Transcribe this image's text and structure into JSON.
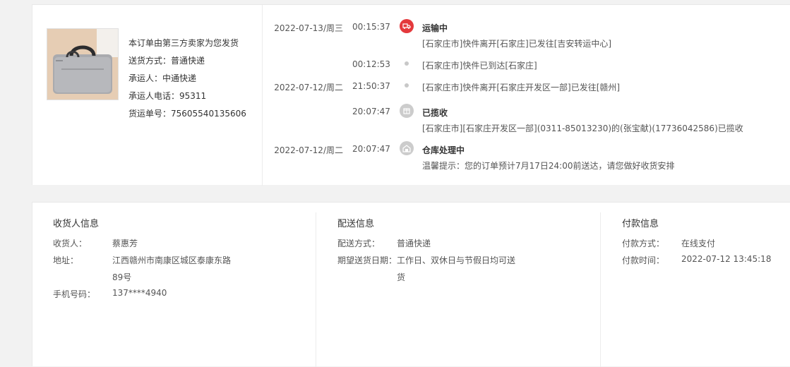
{
  "order": {
    "product_image_label": "product-thumbnail",
    "lines": [
      "本订单由第三方卖家为您发货",
      "送货方式：普通快递",
      "承运人：中通快递",
      "承运人电话：95311",
      "货运单号：75605540135606"
    ]
  },
  "tracking": [
    {
      "date": "2022-07-13/周三",
      "time": "00:15:37",
      "status": "运输中",
      "desc": "[石家庄市]快件离开[石家庄]已发往[吉安转运中心]",
      "icon": "truck-icon",
      "icon_color": "#e4393c"
    },
    {
      "date": "",
      "time": "00:12:53",
      "status": "",
      "desc": "[石家庄市]快件已到达[石家庄]",
      "icon": "dot",
      "icon_color": "#c8c8c8"
    },
    {
      "date": "2022-07-12/周二",
      "time": "21:50:37",
      "status": "",
      "desc": "[石家庄市]快件离开[石家庄开发区一部]已发往[赣州]",
      "icon": "dot",
      "icon_color": "#c8c8c8"
    },
    {
      "date": "",
      "time": "20:07:47",
      "status": "已揽收",
      "desc": "[石家庄市][石家庄开发区一部](0311-85013230)的(张宝献)(17736042586)已揽收",
      "icon": "package-icon",
      "icon_color": "#cccccc"
    },
    {
      "date": "2022-07-12/周二",
      "time": "20:07:47",
      "status": "仓库处理中",
      "desc": "温馨提示：您的订单预计7月17日24:00前送达，请您做好收货安排",
      "icon": "warehouse-icon",
      "icon_color": "#cccccc"
    }
  ],
  "receiver": {
    "title": "收货人信息",
    "name_label": "收货人：",
    "name": "蔡惠芳",
    "address_label": "地址：",
    "address_line1": "江西赣州市南康区城区泰康东路",
    "address_line2": "89号",
    "phone_label": "手机号码：",
    "phone": "137****4940"
  },
  "delivery": {
    "title": "配送信息",
    "method_label": "配送方式：",
    "method": "普通快递",
    "date_label": "期望送货日期：",
    "date_line1": "工作日、双休日与节假日均可送",
    "date_line2": "货"
  },
  "payment": {
    "title": "付款信息",
    "method_label": "付款方式：",
    "method": "在线支付",
    "time_label": "付款时间：",
    "time": "2022-07-12 13:45:18"
  },
  "colors": {
    "accent": "#e4393c",
    "background": "#f2f2f2"
  }
}
